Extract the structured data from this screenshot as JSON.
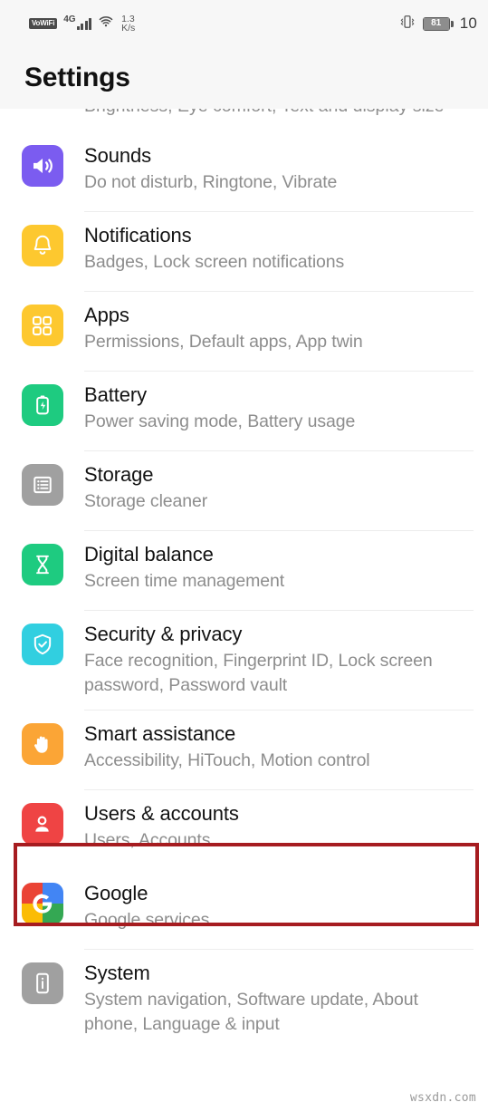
{
  "status_bar": {
    "vowifi_label": "VoWiFi",
    "network_type": "4G",
    "signal_icon": "signal-bars-icon",
    "wifi_icon": "wifi-icon",
    "data_speed_value": "1.3",
    "data_speed_unit": "K/s",
    "vibrate_icon": "vibrate-icon",
    "battery_level": "81",
    "clock": "10"
  },
  "header": {
    "title": "Settings"
  },
  "clipped_item": {
    "subtitle": "Brightness, Eye comfort, Text and display size"
  },
  "colors": {
    "sounds": "#7b5cf0",
    "notifications": "#fdc82f",
    "apps": "#fdc82f",
    "battery": "#1ecb80",
    "storage": "#a0a0a0",
    "digital_balance": "#1ecb80",
    "security": "#31cfe0",
    "smart_assistance": "#fba536",
    "users_accounts": "#ef4444",
    "system": "#a0a0a0",
    "highlight": "#a61c20"
  },
  "items": [
    {
      "title": "Sounds",
      "subtitle": "Do not disturb, Ringtone, Vibrate",
      "icon": "speaker-icon",
      "name": "settings-item-sounds"
    },
    {
      "title": "Notifications",
      "subtitle": "Badges, Lock screen notifications",
      "icon": "bell-icon",
      "name": "settings-item-notifications"
    },
    {
      "title": "Apps",
      "subtitle": "Permissions, Default apps, App twin",
      "icon": "grid-icon",
      "name": "settings-item-apps"
    },
    {
      "title": "Battery",
      "subtitle": "Power saving mode, Battery usage",
      "icon": "battery-charging-icon",
      "name": "settings-item-battery"
    },
    {
      "title": "Storage",
      "subtitle": "Storage cleaner",
      "icon": "storage-list-icon",
      "name": "settings-item-storage"
    },
    {
      "title": "Digital balance",
      "subtitle": "Screen time management",
      "icon": "hourglass-icon",
      "name": "settings-item-digital-balance"
    },
    {
      "title": "Security & privacy",
      "subtitle": "Face recognition, Fingerprint ID, Lock screen password, Password vault",
      "icon": "shield-check-icon",
      "name": "settings-item-security-privacy"
    },
    {
      "title": "Smart assistance",
      "subtitle": "Accessibility, HiTouch, Motion control",
      "icon": "hand-icon",
      "name": "settings-item-smart-assistance"
    },
    {
      "title": "Users & accounts",
      "subtitle": "Users, Accounts",
      "icon": "person-icon",
      "name": "settings-item-users-accounts"
    },
    {
      "title": "Google",
      "subtitle": "Google services",
      "icon": "google-g-icon",
      "name": "settings-item-google"
    },
    {
      "title": "System",
      "subtitle": "System navigation, Software update, About phone, Language & input",
      "icon": "phone-info-icon",
      "name": "settings-item-system"
    }
  ],
  "watermark": "wsxdn.com"
}
